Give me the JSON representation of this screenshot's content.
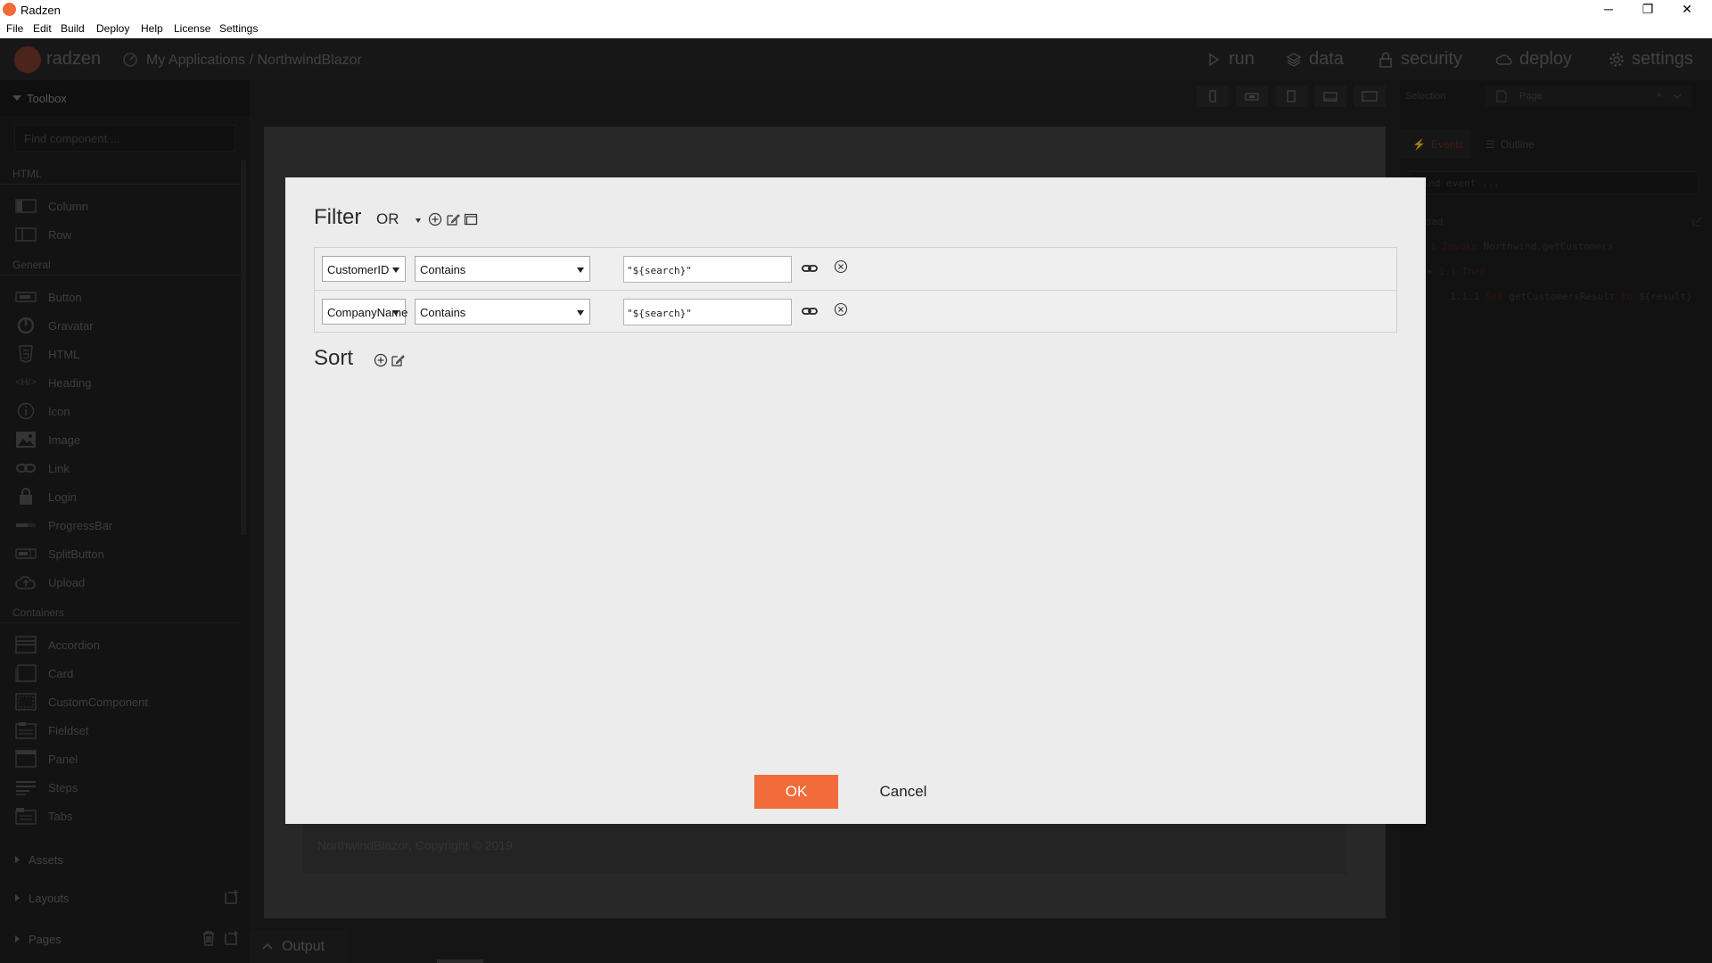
{
  "window": {
    "title": "Radzen",
    "controls": {
      "minimize": "─",
      "restore": "❐",
      "close": "✕"
    }
  },
  "menubar": [
    "File",
    "Edit",
    "Build",
    "Deploy",
    "Help",
    "License",
    "Settings"
  ],
  "header": {
    "logo": "radzen",
    "breadcrumb": "My Applications / NorthwindBlazor",
    "nav": [
      "run",
      "data",
      "security",
      "deploy",
      "settings"
    ]
  },
  "sidebar": {
    "title": "Toolbox",
    "search_placeholder": "Find component ...",
    "sections": {
      "html": "HTML",
      "general": "General",
      "containers": "Containers"
    },
    "html_items": [
      "Column",
      "Row"
    ],
    "general_items": [
      "Button",
      "Gravatar",
      "HTML",
      "Heading",
      "Icon",
      "Image",
      "Link",
      "Login",
      "ProgressBar",
      "SplitButton",
      "Upload"
    ],
    "container_items": [
      "Accordion",
      "Card",
      "CustomComponent",
      "Fieldset",
      "Panel",
      "Steps",
      "Tabs"
    ],
    "bottom": [
      "Assets",
      "Layouts",
      "Pages"
    ]
  },
  "canvas": {
    "footer_text": "NorthwindBlazor, Copyright © 2019"
  },
  "output_tab": "Output",
  "right_panel": {
    "selection_label": "Selection",
    "selection_value": "Page",
    "tabs": [
      "Events",
      "Outline"
    ],
    "find_placeholder": "Find event ...",
    "events": {
      "load": "Load",
      "line1_num": "1",
      "line1_kw": "Invoke",
      "line1_text": "Northwind.getCustomers",
      "line2_num": "1.1",
      "line2_kw": "Then",
      "line3_num": "1.1.1",
      "line3_kw": "Set",
      "line3_text": "getCustomersResult",
      "line3_kw2": "to",
      "line3_val": "${result}"
    }
  },
  "dialog": {
    "filter_title": "Filter",
    "filter_operator": "OR",
    "sort_title": "Sort",
    "filters": [
      {
        "field": "CustomerID",
        "operator": "Contains",
        "value": "\"${search}\""
      },
      {
        "field": "CompanyName",
        "operator": "Contains",
        "value": "\"${search}\""
      }
    ],
    "ok_label": "OK",
    "cancel_label": "Cancel"
  }
}
